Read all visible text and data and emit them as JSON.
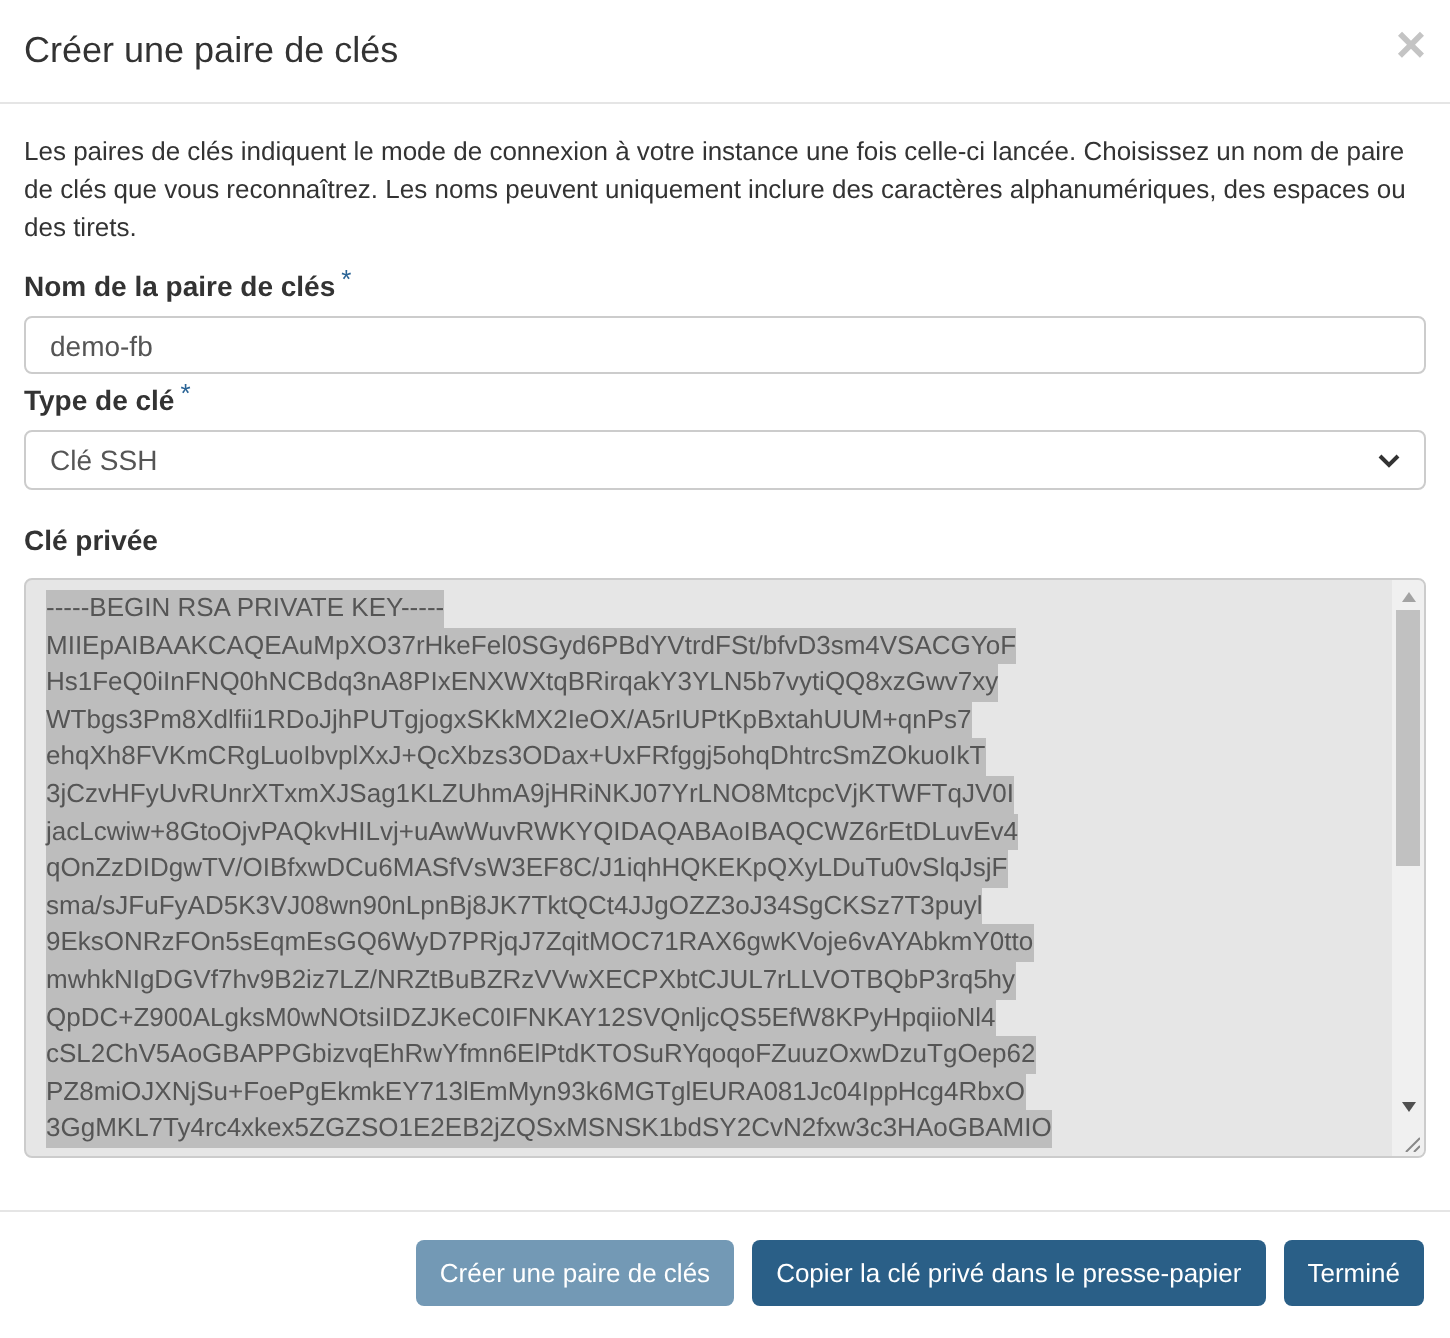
{
  "dialog": {
    "title": "Créer une paire de clés",
    "close_symbol": "×"
  },
  "description": "Les paires de clés indiquent le mode de connexion à votre instance une fois celle-ci lancée. Choisissez un nom de paire de clés que vous reconnaîtrez. Les noms peuvent uniquement inclure des caractères alphanumériques, des espaces ou des tirets.",
  "fields": [
    {
      "kind": "text",
      "label": "Nom de la paire de clés",
      "required_mark": "*",
      "value": "demo-fb"
    },
    {
      "kind": "select",
      "label": "Type de clé",
      "required_mark": "*",
      "value": "Clé SSH"
    },
    {
      "kind": "textarea",
      "label": "Clé privée",
      "text_selected": true,
      "lines": [
        "-----BEGIN RSA PRIVATE KEY-----",
        "MIIEpAIBAAKCAQEAuMpXO37rHkeFel0SGyd6PBdYVtrdFSt/bfvD3sm4VSACGYoF",
        "Hs1FeQ0iInFNQ0hNCBdq3nA8PIxENXWXtqBRirqakY3YLN5b7vytiQQ8xzGwv7xy",
        "WTbgs3Pm8Xdlfii1RDoJjhPUTgjogxSKkMX2IeOX/A5rIUPtKpBxtahUUM+qnPs7",
        "ehqXh8FVKmCRgLuoIbvplXxJ+QcXbzs3ODax+UxFRfggj5ohqDhtrcSmZOkuoIkT",
        "3jCzvHFyUvRUnrXTxmXJSag1KLZUhmA9jHRiNKJ07YrLNO8MtcpcVjKTWFTqJV0I",
        "jacLcwiw+8GtoOjvPAQkvHILvj+uAwWuvRWKYQIDAQABAoIBAQCWZ6rEtDLuvEv4",
        "qOnZzDIDgwTV/OIBfxwDCu6MASfVsW3EF8C/J1iqhHQKEKpQXyLDuTu0vSlqJsjF",
        "sma/sJFuFyAD5K3VJ08wn90nLpnBj8JK7TktQCt4JJgOZZ3oJ34SgCKSz7T3puyl",
        "9EksONRzFOn5sEqmEsGQ6WyD7PRjqJ7ZqitMOC71RAX6gwKVoje6vAYAbkmY0tto",
        "mwhkNIgDGVf7hv9B2iz7LZ/NRZtBuBZRzVVwXECPXbtCJUL7rLLVOTBQbP3rq5hy",
        "QpDC+Z900ALgksM0wNOtsiIDZJKeC0IFNKAY12SVQnljcQS5EfW8KPyHpqiioNl4",
        "cSL2ChV5AoGBAPPGbizvqEhRwYfmn6ElPtdKTOSuRYqoqoFZuuzOxwDzuTgOep62",
        "PZ8miOJXNjSu+FoePgEkmkEY713lEmMyn93k6MGTglEURA081Jc04IppHcg4RbxO",
        "3GgMKL7Ty4rc4xkex5ZGZSO1E2EB2jZQSxMSNSK1bdSY2CvN2fxw3c3HAoGBAMIO"
      ]
    }
  ],
  "buttons": [
    {
      "label": "Créer une paire de clés",
      "disabled": true
    },
    {
      "label": "Copier la clé privé dans le presse-papier",
      "disabled": false
    },
    {
      "label": "Terminé",
      "disabled": false
    }
  ]
}
